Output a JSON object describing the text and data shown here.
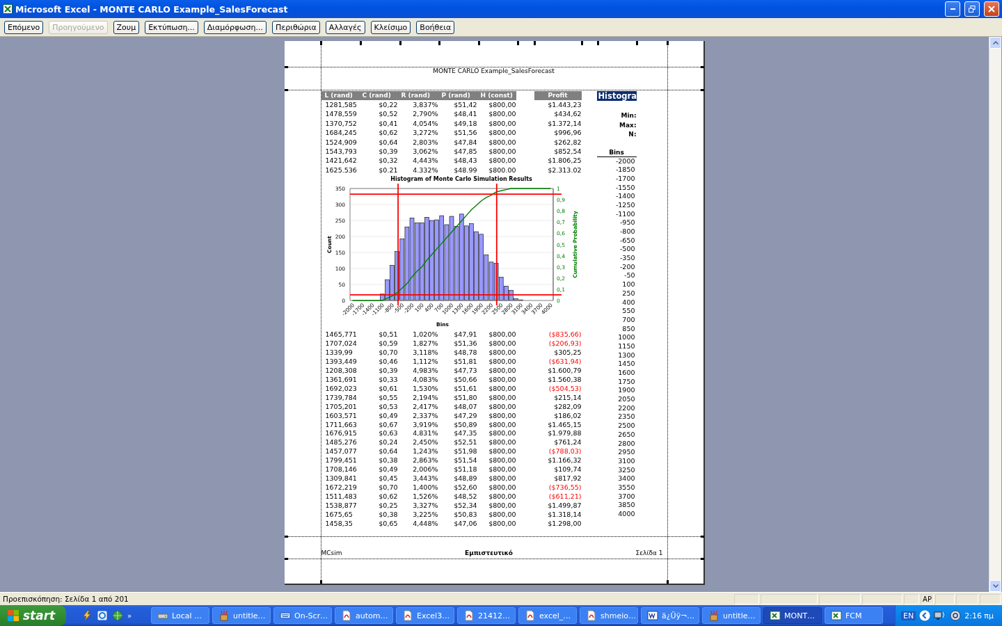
{
  "window": {
    "title": "Microsoft Excel - MONTE CARLO Example_SalesForecast"
  },
  "toolbar": {
    "buttons": [
      {
        "label": "Επόμενο",
        "disabled": false
      },
      {
        "label": "Προηγούμενο",
        "disabled": true
      },
      {
        "label": "Ζουμ",
        "disabled": false
      },
      {
        "label": "Εκτύπωση...",
        "disabled": false
      },
      {
        "label": "Διαμόρφωση...",
        "disabled": false
      },
      {
        "label": "Περιθώρια",
        "disabled": false
      },
      {
        "label": "Αλλαγές",
        "disabled": false
      },
      {
        "label": "Κλείσιμο",
        "disabled": false
      },
      {
        "label": "Βοήθεια",
        "disabled": false
      }
    ]
  },
  "page": {
    "header_text": "MONTE CARLO Example_SalesForecast",
    "columns": [
      "L (rand)",
      "C (rand)",
      "R (rand)",
      "P (rand)",
      "H (const)"
    ],
    "profit_column": "Profit",
    "rows_top": [
      {
        "cells": [
          "1281,585",
          "$0,22",
          "3,837%",
          "$51,42",
          "$800,00"
        ],
        "profit": "$1.443,23",
        "negative": false
      },
      {
        "cells": [
          "1478,559",
          "$0,52",
          "2,790%",
          "$48,41",
          "$800,00"
        ],
        "profit": "$434,62",
        "negative": false
      },
      {
        "cells": [
          "1370,752",
          "$0,41",
          "4,054%",
          "$49,18",
          "$800,00"
        ],
        "profit": "$1.372,14",
        "negative": false
      },
      {
        "cells": [
          "1684,245",
          "$0,62",
          "3,272%",
          "$51,56",
          "$800,00"
        ],
        "profit": "$996,96",
        "negative": false
      },
      {
        "cells": [
          "1524,909",
          "$0,64",
          "2,803%",
          "$47,84",
          "$800,00"
        ],
        "profit": "$262,82",
        "negative": false
      },
      {
        "cells": [
          "1543,793",
          "$0,39",
          "3,062%",
          "$47,85",
          "$800,00"
        ],
        "profit": "$852,54",
        "negative": false
      },
      {
        "cells": [
          "1421,642",
          "$0,32",
          "4,443%",
          "$48,43",
          "$800,00"
        ],
        "profit": "$1.806,25",
        "negative": false
      },
      {
        "cells": [
          "1625.536",
          "$0.21",
          "4.332%",
          "$48.99",
          "$800.00"
        ],
        "profit": "$2.313.02",
        "negative": false
      }
    ],
    "histogram_chart": {
      "chart_data": {
        "type": "bar",
        "title": "Histogram of Monte Carlo Simulation Results",
        "xlabel": "Bins",
        "ylabel": "Count",
        "x": [
          -1100,
          -950,
          -800,
          -650,
          -500,
          -350,
          -200,
          -50,
          100,
          250,
          400,
          550,
          700,
          850,
          1000,
          1150,
          1300,
          1450,
          1600,
          1750,
          1900,
          2050,
          2200,
          2350,
          2500,
          2650,
          2800,
          2950,
          3100
        ],
        "series": [
          {
            "color": "#9999ff",
            "values": [
              20,
              65,
              110,
              153,
              193,
              230,
              258,
              243,
              243,
              260,
              250,
              252,
              265,
              237,
              263,
              232,
              270,
              233,
              240,
              215,
              207,
              143,
              120,
              116,
              73,
              45,
              32,
              6,
              2
            ]
          }
        ],
        "xlim": [
          -2075,
          4075
        ],
        "ylim": [
          0,
          350
        ],
        "yticks": [
          0,
          50,
          100,
          150,
          200,
          250,
          300,
          350
        ],
        "xticks": [
          -2000,
          -1700,
          -1400,
          -1100,
          -800,
          -500,
          -200,
          100,
          400,
          700,
          1000,
          1300,
          1600,
          1900,
          2200,
          2500,
          2800,
          3100,
          3400,
          3700,
          4000
        ],
        "grid": true,
        "ref_lines": [
          {
            "axis": "x",
            "value": -620
          },
          {
            "axis": "x",
            "value": 2365
          }
        ]
      }
    },
    "cumulative_chart": {
      "chart_data": {
        "type": "line",
        "ylabel": "Cumulative Probability",
        "x": [
          -2000,
          -1850,
          -1700,
          -1550,
          -1400,
          -1250,
          -1100,
          -950,
          -800,
          -650,
          -500,
          -350,
          -200,
          -50,
          100,
          250,
          400,
          550,
          700,
          850,
          1000,
          1150,
          1300,
          1450,
          1600,
          1750,
          1900,
          2050,
          2200,
          2350,
          2500,
          2650,
          2800,
          2950,
          3100,
          3250,
          3400,
          3550,
          3700,
          3850,
          4000
        ],
        "series": [
          {
            "color": "#008000",
            "values": [
              0,
              0,
              0,
              0,
              0,
              0,
              0,
              0.02,
              0.04,
              0.07,
              0.11,
              0.15,
              0.21,
              0.26,
              0.3,
              0.36,
              0.41,
              0.46,
              0.51,
              0.56,
              0.61,
              0.66,
              0.71,
              0.76,
              0.81,
              0.85,
              0.89,
              0.92,
              0.94,
              0.97,
              0.98,
              0.99,
              1,
              1,
              1,
              1,
              1,
              1,
              1,
              1,
              1
            ]
          }
        ],
        "xlim": [
          -2075,
          4075
        ],
        "ylim": [
          0,
          1
        ],
        "yticks": [
          {
            "value": 0,
            "label": "0"
          },
          {
            "value": 0.1,
            "label": "0,1"
          },
          {
            "value": 0.2,
            "label": "0,2"
          },
          {
            "value": 0.3,
            "label": "0,3"
          },
          {
            "value": 0.4,
            "label": "0,4"
          },
          {
            "value": 0.5,
            "label": "0,5"
          },
          {
            "value": 0.6,
            "label": "0,6"
          },
          {
            "value": 0.7,
            "label": "0,7"
          },
          {
            "value": 0.8,
            "label": "0,8"
          },
          {
            "value": 0.9,
            "label": "0,9"
          },
          {
            "value": 1,
            "label": "1"
          }
        ],
        "ref_lines": [
          {
            "axis": "y",
            "value": 0.05
          },
          {
            "axis": "y",
            "value": 0.95
          }
        ]
      }
    },
    "rows_bottom": [
      {
        "cells": [
          "1465,771",
          "$0,51",
          "1,020%",
          "$47,91",
          "$800,00"
        ],
        "profit": "($835,66)",
        "negative": true
      },
      {
        "cells": [
          "1707,024",
          "$0,59",
          "1,827%",
          "$51,36",
          "$800,00"
        ],
        "profit": "($206,93)",
        "negative": true
      },
      {
        "cells": [
          "1339,99",
          "$0,70",
          "3,118%",
          "$48,78",
          "$800,00"
        ],
        "profit": "$305,25",
        "negative": false
      },
      {
        "cells": [
          "1393,449",
          "$0,46",
          "1,112%",
          "$51,81",
          "$800,00"
        ],
        "profit": "($631,94)",
        "negative": true
      },
      {
        "cells": [
          "1208,308",
          "$0,39",
          "4,983%",
          "$47,73",
          "$800,00"
        ],
        "profit": "$1.600,79",
        "negative": false
      },
      {
        "cells": [
          "1361,691",
          "$0,33",
          "4,083%",
          "$50,66",
          "$800,00"
        ],
        "profit": "$1.560,38",
        "negative": false
      },
      {
        "cells": [
          "1692,023",
          "$0,61",
          "1,530%",
          "$51,61",
          "$800,00"
        ],
        "profit": "($504,53)",
        "negative": true
      },
      {
        "cells": [
          "1739,784",
          "$0,55",
          "2,194%",
          "$51,80",
          "$800,00"
        ],
        "profit": "$215,14",
        "negative": false
      },
      {
        "cells": [
          "1705,201",
          "$0,53",
          "2,417%",
          "$48,07",
          "$800,00"
        ],
        "profit": "$282,09",
        "negative": false
      },
      {
        "cells": [
          "1603,571",
          "$0,49",
          "2,337%",
          "$47,29",
          "$800,00"
        ],
        "profit": "$186,02",
        "negative": false
      },
      {
        "cells": [
          "1711,663",
          "$0,67",
          "3,919%",
          "$50,89",
          "$800,00"
        ],
        "profit": "$1.465,15",
        "negative": false
      },
      {
        "cells": [
          "1676,915",
          "$0,63",
          "4,831%",
          "$47,35",
          "$800,00"
        ],
        "profit": "$1.979,88",
        "negative": false
      },
      {
        "cells": [
          "1485,276",
          "$0,24",
          "2,450%",
          "$52,51",
          "$800,00"
        ],
        "profit": "$761,24",
        "negative": false
      },
      {
        "cells": [
          "1457,077",
          "$0,64",
          "1,243%",
          "$51,98",
          "$800,00"
        ],
        "profit": "($788,03)",
        "negative": true
      },
      {
        "cells": [
          "1799,451",
          "$0,38",
          "2,863%",
          "$51,54",
          "$800,00"
        ],
        "profit": "$1.166,32",
        "negative": false
      },
      {
        "cells": [
          "1708,146",
          "$0,49",
          "2,006%",
          "$51,18",
          "$800,00"
        ],
        "profit": "$109,74",
        "negative": false
      },
      {
        "cells": [
          "1309,841",
          "$0,45",
          "3,443%",
          "$48,89",
          "$800,00"
        ],
        "profit": "$817,92",
        "negative": false
      },
      {
        "cells": [
          "1672,219",
          "$0,70",
          "1,400%",
          "$52,60",
          "$800,00"
        ],
        "profit": "($736,55)",
        "negative": true
      },
      {
        "cells": [
          "1511,483",
          "$0,62",
          "1,526%",
          "$48,52",
          "$800,00"
        ],
        "profit": "($611,21)",
        "negative": true
      },
      {
        "cells": [
          "1538,877",
          "$0,25",
          "3,327%",
          "$52,34",
          "$800,00"
        ],
        "profit": "$1.499,87",
        "negative": false
      },
      {
        "cells": [
          "1675,65",
          "$0,38",
          "3,225%",
          "$50,83",
          "$800,00"
        ],
        "profit": "$1.318,14",
        "negative": false
      },
      {
        "cells": [
          "1458,35",
          "$0,65",
          "4,448%",
          "$47,06",
          "$800,00"
        ],
        "profit": "$1.298,00",
        "negative": false
      }
    ],
    "histogram_panel": {
      "title": "Histogra",
      "labels": [
        "Min:",
        "Max:",
        "N:"
      ],
      "bins_heading": "Bins",
      "bins": [
        "-2000",
        "-1850",
        "-1700",
        "-1550",
        "-1400",
        "-1250",
        "-1100",
        "-950",
        "-800",
        "-650",
        "-500",
        "-350",
        "-200",
        "-50",
        "100",
        "250",
        "400",
        "550",
        "700",
        "850",
        "1000",
        "1150",
        "1300",
        "1450",
        "1600",
        "1750",
        "1900",
        "2050",
        "2200",
        "2350",
        "2500",
        "2650",
        "2800",
        "2950",
        "3100",
        "3250",
        "3400",
        "3550",
        "3700",
        "3850",
        "4000"
      ]
    },
    "footer": {
      "left": "MCsim",
      "center": "Εμπιστευτικό",
      "right": "Σελίδα 1"
    }
  },
  "status_bar": {
    "text": "Προεπισκόπηση: Σελίδα 1 από 201",
    "indicator": "AP"
  },
  "taskbar": {
    "start": "start",
    "overflow": "»",
    "tasks": [
      {
        "label": "Local …",
        "kind": "drive",
        "selected": false
      },
      {
        "label": "untitle…",
        "kind": "paint",
        "selected": false
      },
      {
        "label": "On-Scr…",
        "kind": "keyboard",
        "selected": false
      },
      {
        "label": "autom…",
        "kind": "pdf",
        "selected": false
      },
      {
        "label": "Excel3…",
        "kind": "pdf",
        "selected": false
      },
      {
        "label": "21412…",
        "kind": "pdf",
        "selected": false
      },
      {
        "label": "excel_…",
        "kind": "pdf",
        "selected": false
      },
      {
        "label": "shmeio…",
        "kind": "pdf",
        "selected": false
      },
      {
        "label": "ä¿Üÿ¬…",
        "kind": "word",
        "selected": false
      },
      {
        "label": "untitle…",
        "kind": "paint",
        "selected": false
      },
      {
        "label": "MONT…",
        "kind": "excel",
        "selected": true
      },
      {
        "label": "FCM",
        "kind": "excel",
        "selected": false
      }
    ],
    "language": "EN",
    "clock": "2:16 πμ"
  }
}
